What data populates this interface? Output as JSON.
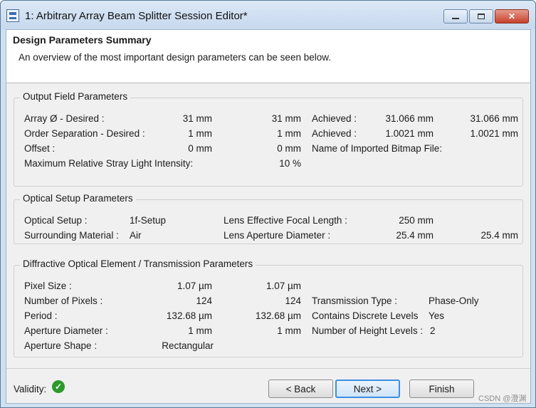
{
  "window": {
    "title": "1: Arbitrary Array Beam Splitter Session Editor*",
    "controls": {
      "minimize": "",
      "maximize": "",
      "close": "✕"
    }
  },
  "header": {
    "title": "Design Parameters Summary",
    "description": "An overview of the most important design parameters can be seen below."
  },
  "output_field": {
    "title": "Output Field Parameters",
    "rows": [
      {
        "label": "Array Ø   - Desired :",
        "v1": "31 mm",
        "v2": "31 mm",
        "label2": "Achieved :",
        "v3": "31.066 mm",
        "v4": "31.066 mm"
      },
      {
        "label": "Order Separation - Desired :",
        "v1": "1 mm",
        "v2": "1 mm",
        "label2": "Achieved :",
        "v3": "1.0021 mm",
        "v4": "1.0021 mm"
      },
      {
        "label": "Offset :",
        "v1": "0 mm",
        "v2": "0 mm",
        "label2": "Name of Imported Bitmap File:",
        "v3": "",
        "v4": ""
      },
      {
        "label": "Maximum Relative Stray Light Intensity:",
        "v1": "",
        "v2": "10 %",
        "label2": "",
        "v3": "",
        "v4": ""
      }
    ]
  },
  "optical_setup": {
    "title": "Optical Setup Parameters",
    "rows": [
      {
        "label": "Optical Setup :",
        "value": "1f-Setup",
        "label2": "Lens Effective Focal Length :",
        "v3": "250 mm",
        "v4": ""
      },
      {
        "label": "Surrounding Material :",
        "value": "Air",
        "label2": "Lens Aperture Diameter :",
        "v3": "25.4 mm",
        "v4": "25.4 mm"
      }
    ]
  },
  "doe": {
    "title": "Diffractive Optical Element / Transmission Parameters",
    "rows": [
      {
        "label": "Pixel Size :",
        "v1": "1.07 µm",
        "v2": "1.07 µm",
        "label2": "",
        "v3": ""
      },
      {
        "label": "Number of Pixels :",
        "v1": "124",
        "v2": "124",
        "label2": "Transmission Type :",
        "v3": "Phase-Only"
      },
      {
        "label": "Period :",
        "v1": "132.68 µm",
        "v2": "132.68 µm",
        "label2": "Contains Discrete Levels",
        "v3": "Yes"
      },
      {
        "label": "Aperture Diameter :",
        "v1": "1 mm",
        "v2": "1 mm",
        "label2": "Number of Height Levels :",
        "v3": "2"
      },
      {
        "label": "Aperture Shape :",
        "v1": "Rectangular",
        "v2": "",
        "label2": "",
        "v3": ""
      }
    ]
  },
  "footer": {
    "validity_label": "Validity:",
    "validity_icon": "check-circle-icon",
    "back": "< Back",
    "next": "Next >",
    "finish": "Finish",
    "watermark": "CSDN @澄渊"
  }
}
